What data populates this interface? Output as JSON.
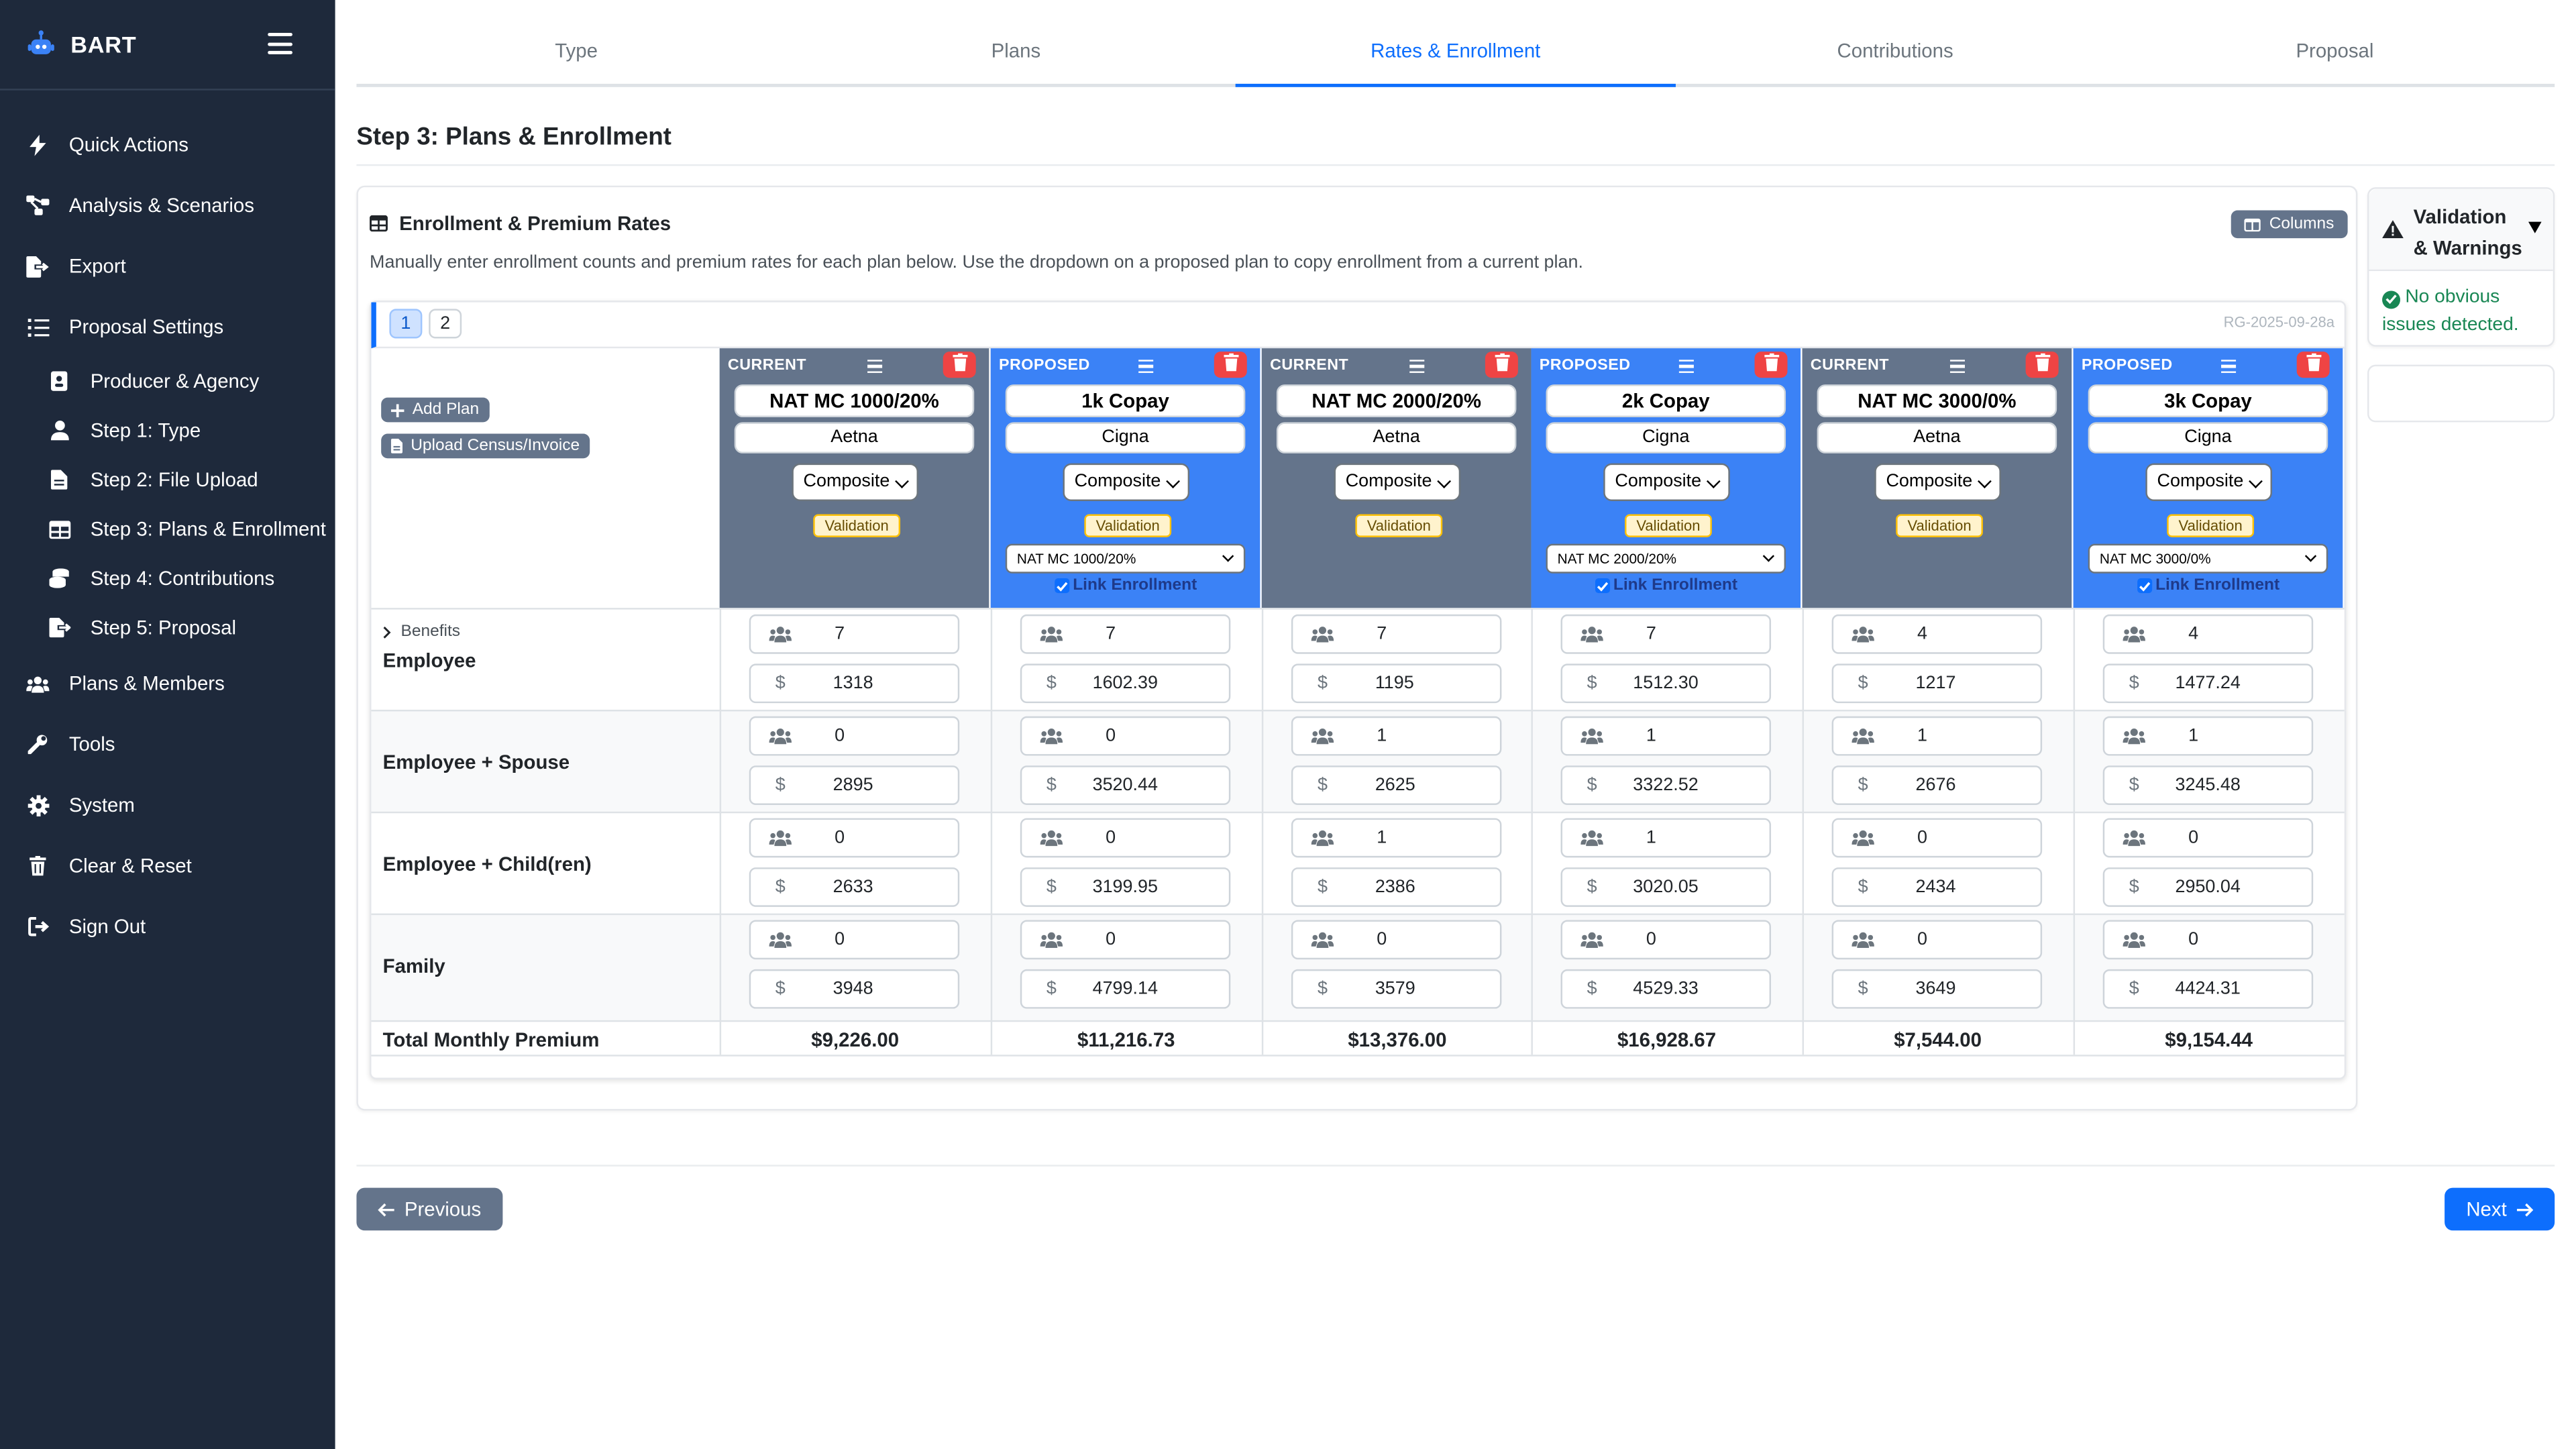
{
  "app": {
    "title": "BART"
  },
  "sidebar": {
    "items": [
      {
        "label": "Quick Actions",
        "icon": "bolt-icon"
      },
      {
        "label": "Analysis & Scenarios",
        "icon": "sitemap-icon"
      },
      {
        "label": "Export",
        "icon": "file-export-icon"
      },
      {
        "label": "Proposal Settings",
        "icon": "list-icon"
      },
      {
        "label": "Producer & Agency",
        "icon": "id-badge-icon"
      },
      {
        "label": "Step 1: Type",
        "icon": "user-icon"
      },
      {
        "label": "Step 2: File Upload",
        "icon": "file-icon"
      },
      {
        "label": "Step 3: Plans & Enrollment",
        "icon": "table-icon"
      },
      {
        "label": "Step 4: Contributions",
        "icon": "coins-icon"
      },
      {
        "label": "Step 5: Proposal",
        "icon": "file-export-icon"
      },
      {
        "label": "Plans & Members",
        "icon": "users-icon"
      },
      {
        "label": "Tools",
        "icon": "wrench-icon"
      },
      {
        "label": "System",
        "icon": "gear-icon"
      },
      {
        "label": "Clear & Reset",
        "icon": "trash-icon"
      },
      {
        "label": "Sign Out",
        "icon": "sign-out-icon"
      }
    ]
  },
  "tabs": [
    "Type",
    "Plans",
    "Rates & Enrollment",
    "Contributions",
    "Proposal"
  ],
  "active_tab": "Rates & Enrollment",
  "page": {
    "title": "Step 3: Plans & Enrollment"
  },
  "card": {
    "title": "Enrollment & Premium Rates",
    "columns_label": "Columns",
    "description": "Manually enter enrollment counts and premium rates for each plan below. Use the dropdown on a proposed plan to copy enrollment from a current plan.",
    "pages": [
      "1",
      "2"
    ],
    "scenario_id": "RG-2025-09-28a",
    "add_plan": "Add Plan",
    "upload": "Upload Census/Invoice",
    "benefits": "Benefits"
  },
  "plans": [
    {
      "type": "CURRENT",
      "name": "NAT MC 1000/20%",
      "carrier": "Aetna",
      "rate": "Composite",
      "validation": "Validation"
    },
    {
      "type": "PROPOSED",
      "name": "1k Copay",
      "carrier": "Cigna",
      "rate": "Composite",
      "validation": "Validation",
      "copy_from": "NAT MC 1000/20%",
      "link": "Link Enrollment"
    },
    {
      "type": "CURRENT",
      "name": "NAT MC 2000/20%",
      "carrier": "Aetna",
      "rate": "Composite",
      "validation": "Validation"
    },
    {
      "type": "PROPOSED",
      "name": "2k Copay",
      "carrier": "Cigna",
      "rate": "Composite",
      "validation": "Validation",
      "copy_from": "NAT MC 2000/20%",
      "link": "Link Enrollment"
    },
    {
      "type": "CURRENT",
      "name": "NAT MC 3000/0%",
      "carrier": "Aetna",
      "rate": "Composite",
      "validation": "Validation"
    },
    {
      "type": "PROPOSED",
      "name": "3k Copay",
      "carrier": "Cigna",
      "rate": "Composite",
      "validation": "Validation",
      "copy_from": "NAT MC 3000/0%",
      "link": "Link Enrollment"
    }
  ],
  "tiers": [
    {
      "label": "Employee",
      "counts": [
        "7",
        "7",
        "7",
        "7",
        "4",
        "4"
      ],
      "rates": [
        "1318",
        "1602.39",
        "1195",
        "1512.30",
        "1217",
        "1477.24"
      ]
    },
    {
      "label": "Employee + Spouse",
      "counts": [
        "0",
        "0",
        "1",
        "1",
        "1",
        "1"
      ],
      "rates": [
        "2895",
        "3520.44",
        "2625",
        "3322.52",
        "2676",
        "3245.48"
      ]
    },
    {
      "label": "Employee + Child(ren)",
      "counts": [
        "0",
        "0",
        "1",
        "1",
        "0",
        "0"
      ],
      "rates": [
        "2633",
        "3199.95",
        "2386",
        "3020.05",
        "2434",
        "2950.04"
      ]
    },
    {
      "label": "Family",
      "counts": [
        "0",
        "0",
        "0",
        "0",
        "0",
        "0"
      ],
      "rates": [
        "3948",
        "4799.14",
        "3579",
        "4529.33",
        "3649",
        "4424.31"
      ]
    }
  ],
  "currency_symbol": "$",
  "totals": {
    "label": "Total Monthly Premium",
    "values": [
      "$9,226.00",
      "$11,216.73",
      "$13,376.00",
      "$16,928.67",
      "$7,544.00",
      "$9,154.44"
    ]
  },
  "validation": {
    "title_line1": "Validation",
    "title_line2": "& Warnings",
    "message_line1": "No obvious",
    "message_line2": "issues detected."
  },
  "footer": {
    "previous": "Previous",
    "next": "Next"
  },
  "colors": {
    "sidebar": "#1e293b",
    "current_header": "#64748b",
    "proposed_header": "#3b82f6",
    "accent": "#0d6efd",
    "danger": "#ef4444"
  }
}
